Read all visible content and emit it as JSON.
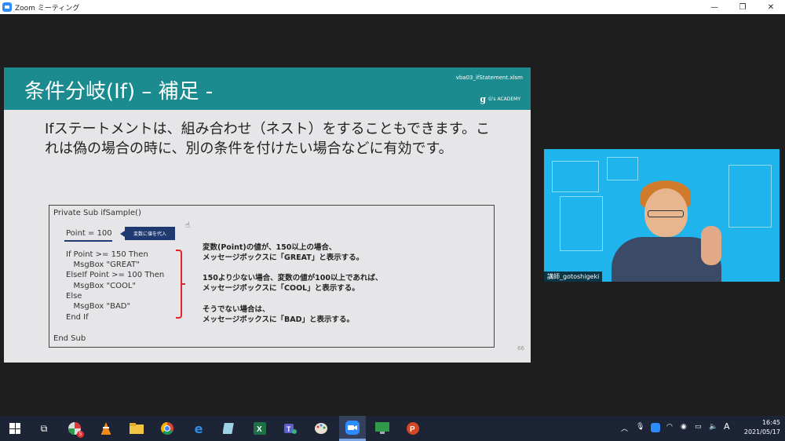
{
  "window": {
    "title": "Zoom ミーティング",
    "minimize": "—",
    "restore": "❐",
    "close": "✕"
  },
  "slide": {
    "title": "条件分岐(If) – 補足 -",
    "file": "vba03_ifStatement.xlsm",
    "brand": "G's ACADEMY",
    "brand_mark": "g",
    "intro": "Ifステートメントは、組み合わせ（ネスト）をすることもできます。これは偽の場合の時に、別の条件を付けたい場合などに有効です。",
    "code": {
      "sub_open": "Private Sub ifSample()",
      "point": "Point = 100",
      "point_note": "変数に値を代入",
      "lines": [
        "If Point >= 150 Then",
        "   MsgBox \"GREAT\"",
        "ElseIf Point >= 100 Then",
        "   MsgBox \"COOL\"",
        "Else",
        "   MsgBox \"BAD\"",
        "End If"
      ],
      "sub_close": "End Sub"
    },
    "explanations": [
      {
        "line1": "変数(Point)の値が、150以上の場合、",
        "line2": "メッセージボックスに「GREAT」と表示する。"
      },
      {
        "line1": "150より少ない場合、変数の値が100以上であれば、",
        "line2": "メッセージボックスに「COOL」と表示する。"
      },
      {
        "line1": "そうでない場合は、",
        "line2": "メッセージボックスに「BAD」と表示する。"
      }
    ],
    "page_number": "66"
  },
  "video": {
    "participant_name": "講師_gotoshigeki"
  },
  "taskbar": {
    "badge_count": "5",
    "time": "16:45",
    "date": "2021/05/17",
    "ime": "A",
    "colors": {
      "bar": "#1c2436",
      "active": "#7aa5e6"
    }
  },
  "colors": {
    "slide_header": "#1b8b8f",
    "accent_red": "#e0242b",
    "navy": "#1f3a70",
    "video_bg": "#1fb4ec"
  }
}
